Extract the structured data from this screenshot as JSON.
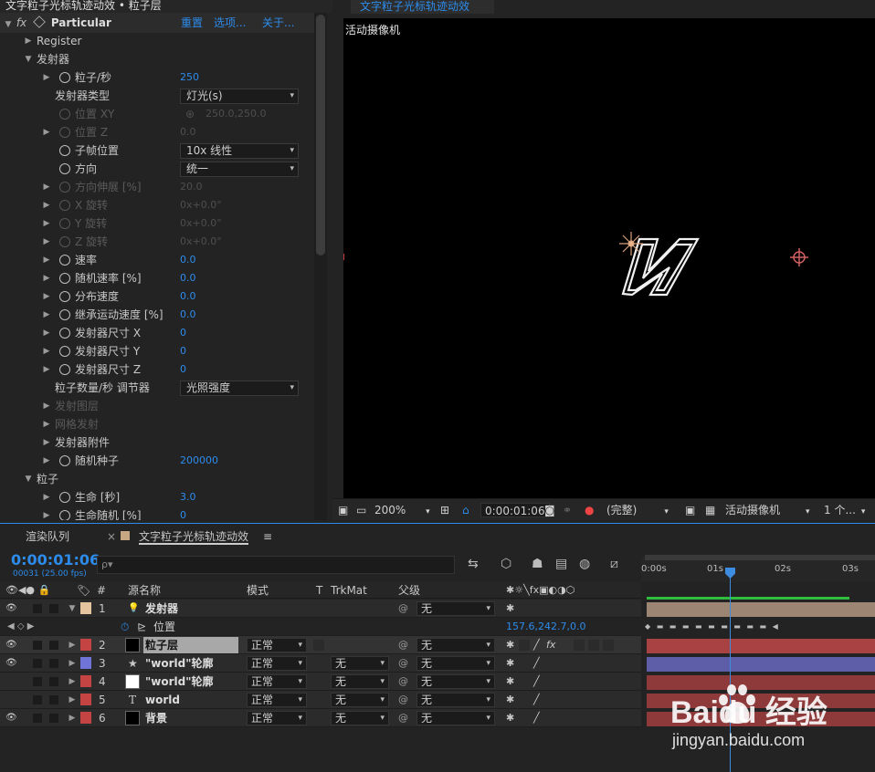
{
  "effect_panel": {
    "title": "文字粒子光标轨迹动效 • 粒子层",
    "fx_prefix": "fx",
    "effect_name": "Particular",
    "reset": "重置",
    "options": "选项...",
    "about": "关于...",
    "rows": [
      {
        "label": "Register",
        "kind": "group",
        "indent": 1
      },
      {
        "label": "发射器",
        "kind": "group-open",
        "indent": 1
      },
      {
        "label": "粒子/秒",
        "kind": "prop",
        "stopwatch": true,
        "value": "250"
      },
      {
        "label": "发射器类型",
        "kind": "dropdown",
        "value": "灯光(s)"
      },
      {
        "label": "位置 XY",
        "kind": "prop-dim",
        "stopwatch": true,
        "value": "250.0,250.0",
        "crosshair": true,
        "no_arrow": true
      },
      {
        "label": "位置 Z",
        "kind": "prop-dim",
        "stopwatch": true,
        "value": "0.0"
      },
      {
        "label": "子帧位置",
        "kind": "dropdown",
        "stopwatch": true,
        "value": "10x 线性"
      },
      {
        "label": "方向",
        "kind": "dropdown",
        "stopwatch": true,
        "value": "统一"
      },
      {
        "label": "方向伸展 [%]",
        "kind": "prop-dim",
        "stopwatch": true,
        "value": "20.0"
      },
      {
        "label": "X 旋转",
        "kind": "prop-dim",
        "stopwatch": true,
        "value": "0x+0.0°"
      },
      {
        "label": "Y 旋转",
        "kind": "prop-dim",
        "stopwatch": true,
        "value": "0x+0.0°"
      },
      {
        "label": "Z 旋转",
        "kind": "prop-dim",
        "stopwatch": true,
        "value": "0x+0.0°"
      },
      {
        "label": "速率",
        "kind": "prop",
        "stopwatch": true,
        "value": "0.0"
      },
      {
        "label": "随机速率 [%]",
        "kind": "prop",
        "stopwatch": true,
        "value": "0.0"
      },
      {
        "label": "分布速度",
        "kind": "prop",
        "stopwatch": true,
        "value": "0.0"
      },
      {
        "label": "继承运动速度 [%]",
        "kind": "prop",
        "stopwatch": true,
        "value": "0.0"
      },
      {
        "label": "发射器尺寸 X",
        "kind": "prop",
        "stopwatch": true,
        "value": "0"
      },
      {
        "label": "发射器尺寸 Y",
        "kind": "prop",
        "stopwatch": true,
        "value": "0"
      },
      {
        "label": "发射器尺寸 Z",
        "kind": "prop",
        "stopwatch": true,
        "value": "0"
      },
      {
        "label": "粒子数量/秒 调节器",
        "kind": "dropdown",
        "value": "光照强度"
      },
      {
        "label": "发射图层",
        "kind": "subgroup-dim"
      },
      {
        "label": "网格发射",
        "kind": "subgroup-dim"
      },
      {
        "label": "发射器附件",
        "kind": "subgroup"
      },
      {
        "label": "随机种子",
        "kind": "prop",
        "stopwatch": true,
        "value": "200000"
      },
      {
        "label": "粒子",
        "kind": "group-open",
        "indent": 1
      },
      {
        "label": "生命 [秒]",
        "kind": "prop",
        "stopwatch": true,
        "value": "3.0"
      },
      {
        "label": "生命随机 [%]",
        "kind": "prop",
        "stopwatch": true,
        "value": "0"
      }
    ]
  },
  "viewer": {
    "tab_label": "文字粒子光标轨迹动效",
    "camera_label": "活动摄像机",
    "toolbar": {
      "zoom": "200%",
      "timecode": "0:00:01:06",
      "resolution": "(完整)",
      "camera": "活动摄像机",
      "views": "1 个..."
    }
  },
  "timeline": {
    "tab_render_queue": "渲染队列",
    "tab_comp": "文字粒子光标轨迹动效",
    "timecode": "0:00:01:06",
    "fps_info": "00031 (25.00 fps)",
    "search_placeholder": "ρ▾",
    "headers": {
      "source_name": "源名称",
      "mode": "模式",
      "t": "T",
      "trkmat": "TrkMat",
      "parent": "父级"
    },
    "ruler_labels": [
      "0:00s",
      "01s",
      "02s",
      "03s"
    ],
    "layers": [
      {
        "num": "1",
        "name": "发射器",
        "mode": "",
        "trkmat": "",
        "parent": "无",
        "label_color": "#e6c4a0",
        "icon": "light",
        "bar_color": "#9c8673",
        "eye": true
      },
      {
        "num": "",
        "name": "位置",
        "property": true,
        "value": "157.6,242.7,0.0"
      },
      {
        "num": "2",
        "name": "粒子层",
        "mode": "正常",
        "trkmat": "",
        "parent": "无",
        "label_color": "#c44444",
        "icon": "solid",
        "thumb": "#000000",
        "bar_color": "#a94343",
        "eye": true,
        "selected": true
      },
      {
        "num": "3",
        "name": "\"world\"轮廓",
        "mode": "正常",
        "trkmat": "无",
        "parent": "无",
        "label_color": "#6f74d6",
        "icon": "star",
        "bar_color": "#5e5ea8",
        "eye": true
      },
      {
        "num": "4",
        "name": "\"world\"轮廓",
        "mode": "正常",
        "trkmat": "无",
        "parent": "无",
        "label_color": "#c44444",
        "icon": "solid",
        "thumb": "#ffffff",
        "bar_color": "#8e3a3a",
        "eye": false
      },
      {
        "num": "5",
        "name": "world",
        "mode": "正常",
        "trkmat": "无",
        "parent": "无",
        "label_color": "#c44444",
        "icon": "text",
        "bar_color": "#8e3a3a",
        "eye": false
      },
      {
        "num": "6",
        "name": "背景",
        "mode": "正常",
        "trkmat": "无",
        "parent": "无",
        "label_color": "#c44444",
        "icon": "solid",
        "thumb": "#000000",
        "bar_color": "#8e3a3a",
        "eye": true
      }
    ]
  },
  "watermark": {
    "brand": "Baidu 经验",
    "url": "jingyan.baidu.com"
  }
}
